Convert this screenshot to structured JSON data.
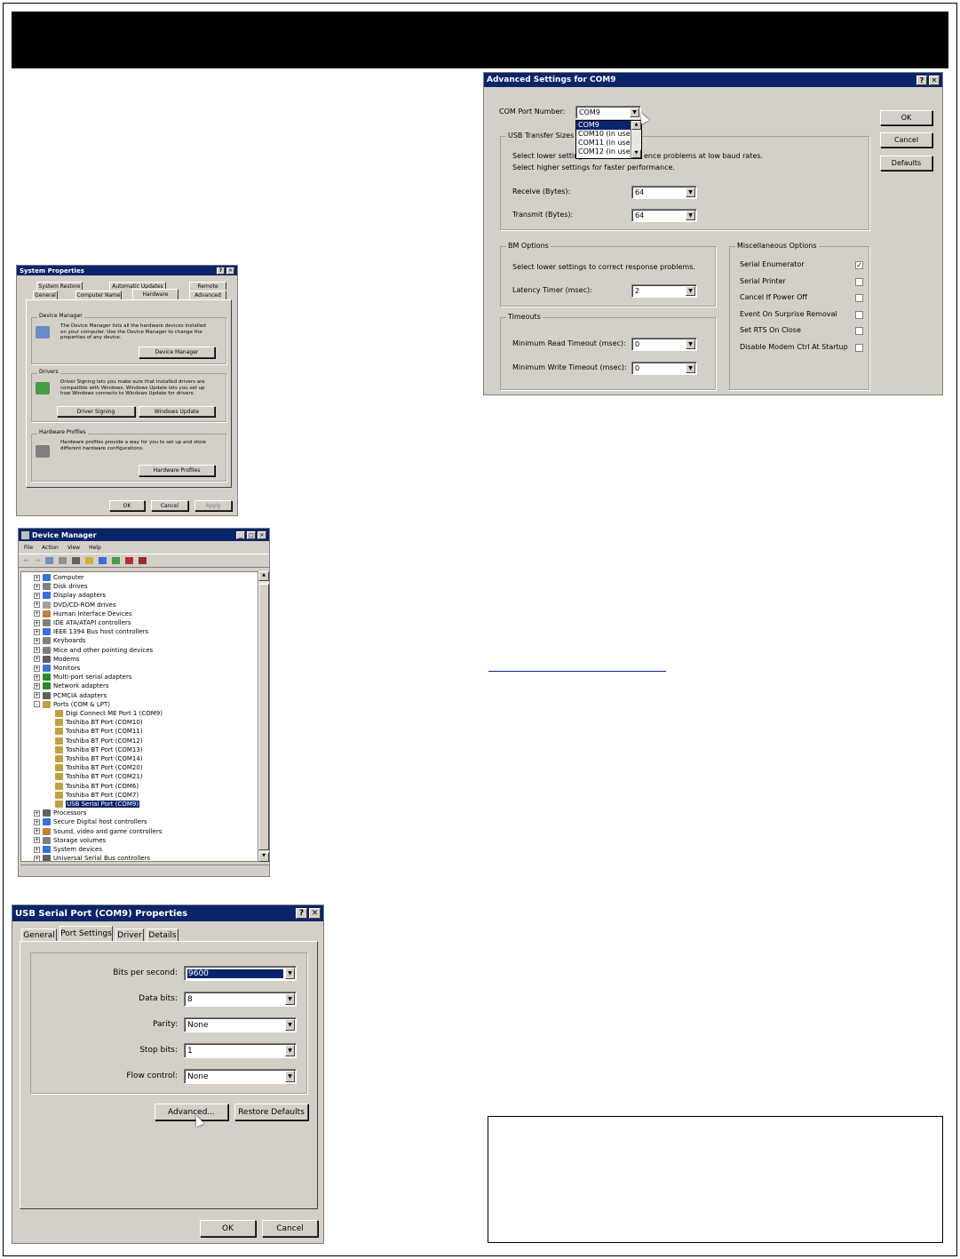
{
  "sysprop": {
    "title": "System Properties",
    "tabs_top": [
      "System Restore",
      "Automatic Updates",
      "Remote"
    ],
    "tabs_bottom": [
      "General",
      "Computer Name",
      "Hardware",
      "Advanced"
    ],
    "device_manager": {
      "group": "Device Manager",
      "text": "The Device Manager lists all the hardware devices installed on your computer. Use the Device Manager to change the properties of any device.",
      "button": "Device Manager"
    },
    "drivers": {
      "group": "Drivers",
      "text": "Driver Signing lets you make sure that installed drivers are compatible with Windows. Windows Update lets you set up how Windows connects to Windows Update for drivers.",
      "btn_signing": "Driver Signing",
      "btn_update": "Windows Update"
    },
    "profiles": {
      "group": "Hardware Profiles",
      "text": "Hardware profiles provide a way for you to set up and store different hardware configurations.",
      "button": "Hardware Profiles"
    },
    "ok": "OK",
    "cancel": "Cancel",
    "apply": "Apply"
  },
  "devmgr": {
    "title": "Device Manager",
    "menu": [
      "File",
      "Action",
      "View",
      "Help"
    ],
    "tree": [
      {
        "label": "Computer",
        "color": "#3a6fd8",
        "exp": "+"
      },
      {
        "label": "Disk drives",
        "color": "#808080",
        "exp": "+"
      },
      {
        "label": "Display adapters",
        "color": "#3a6fd8",
        "exp": "+"
      },
      {
        "label": "DVD/CD-ROM drives",
        "color": "#a0a0a0",
        "exp": "+"
      },
      {
        "label": "Human Interface Devices",
        "color": "#c08040",
        "exp": "+"
      },
      {
        "label": "IDE ATA/ATAPI controllers",
        "color": "#808080",
        "exp": "+"
      },
      {
        "label": "IEEE 1394 Bus host controllers",
        "color": "#3a6fd8",
        "exp": "+"
      },
      {
        "label": "Keyboards",
        "color": "#808080",
        "exp": "+"
      },
      {
        "label": "Mice and other pointing devices",
        "color": "#808080",
        "exp": "+"
      },
      {
        "label": "Modems",
        "color": "#606060",
        "exp": "+"
      },
      {
        "label": "Monitors",
        "color": "#3a6fd8",
        "exp": "+"
      },
      {
        "label": "Multi-port serial adapters",
        "color": "#2a8a2a",
        "exp": "+"
      },
      {
        "label": "Network adapters",
        "color": "#2a8a2a",
        "exp": "+"
      },
      {
        "label": "PCMCIA adapters",
        "color": "#606060",
        "exp": "+"
      },
      {
        "label": "Ports (COM & LPT)",
        "color": "#c0a040",
        "exp": "-"
      },
      {
        "label": "Digi Connect ME Port 1 (COM9)",
        "color": "#c0a040",
        "child": true
      },
      {
        "label": "Toshiba BT Port (COM10)",
        "color": "#c0a040",
        "child": true
      },
      {
        "label": "Toshiba BT Port (COM11)",
        "color": "#c0a040",
        "child": true
      },
      {
        "label": "Toshiba BT Port (COM12)",
        "color": "#c0a040",
        "child": true
      },
      {
        "label": "Toshiba BT Port (COM13)",
        "color": "#c0a040",
        "child": true
      },
      {
        "label": "Toshiba BT Port (COM14)",
        "color": "#c0a040",
        "child": true
      },
      {
        "label": "Toshiba BT Port (COM20)",
        "color": "#c0a040",
        "child": true
      },
      {
        "label": "Toshiba BT Port (COM21)",
        "color": "#c0a040",
        "child": true
      },
      {
        "label": "Toshiba BT Port (COM6)",
        "color": "#c0a040",
        "child": true
      },
      {
        "label": "Toshiba BT Port (COM7)",
        "color": "#c0a040",
        "child": true
      },
      {
        "label": "USB Serial Port (COM9)",
        "color": "#c0a040",
        "child": true,
        "selected": true
      },
      {
        "label": "Processors",
        "color": "#606060",
        "exp": "+"
      },
      {
        "label": "Secure Digital host controllers",
        "color": "#3a6fd8",
        "exp": "+"
      },
      {
        "label": "Sound, video and game controllers",
        "color": "#c08040",
        "exp": "+"
      },
      {
        "label": "Storage volumes",
        "color": "#808080",
        "exp": "+"
      },
      {
        "label": "System devices",
        "color": "#3a6fd8",
        "exp": "+"
      },
      {
        "label": "Universal Serial Bus controllers",
        "color": "#606060",
        "exp": "+"
      }
    ]
  },
  "usbprop": {
    "title": "USB Serial Port (COM9) Properties",
    "tabs": [
      "General",
      "Port Settings",
      "Driver",
      "Details"
    ],
    "fields": [
      {
        "label": "Bits per second:",
        "value": "9600",
        "selected": true
      },
      {
        "label": "Data bits:",
        "value": "8"
      },
      {
        "label": "Parity:",
        "value": "None"
      },
      {
        "label": "Stop bits:",
        "value": "1"
      },
      {
        "label": "Flow control:",
        "value": "None"
      }
    ],
    "advanced": "Advanced...",
    "restore": "Restore Defaults",
    "ok": "OK",
    "cancel": "Cancel"
  },
  "advanced": {
    "title": "Advanced Settings for COM9",
    "com_label": "COM Port Number:",
    "com_value": "COM9",
    "com_options": [
      "COM9",
      "COM10 (in use)",
      "COM11 (in use)",
      "COM12 (in use)"
    ],
    "usb_group": "USB Transfer Sizes",
    "usb_text1": "Select lower settings to correct performance problems at low baud rates.",
    "usb_text1_visible": "Select lower setting",
    "usb_text1_tail": "ence problems at low baud rates.",
    "usb_text2": "Select higher settings for faster performance.",
    "receive_label": "Receive (Bytes):",
    "receive_value": "64",
    "transmit_label": "Transmit (Bytes):",
    "transmit_value": "64",
    "bm_group": "BM Options",
    "bm_text": "Select lower settings to correct response problems.",
    "latency_label": "Latency Timer (msec):",
    "latency_value": "2",
    "timeouts_group": "Timeouts",
    "read_label": "Minimum Read Timeout (msec):",
    "read_value": "0",
    "write_label": "Minimum Write Timeout (msec):",
    "write_value": "0",
    "misc_group": "Miscellaneous Options",
    "misc": [
      {
        "label": "Serial Enumerator",
        "checked": true
      },
      {
        "label": "Serial Printer",
        "checked": false
      },
      {
        "label": "Cancel If Power Off",
        "checked": false
      },
      {
        "label": "Event On Surprise Removal",
        "checked": false
      },
      {
        "label": "Set RTS On Close",
        "checked": false
      },
      {
        "label": "Disable Modem Ctrl At Startup",
        "checked": false
      }
    ],
    "ok": "OK",
    "cancel": "Cancel",
    "defaults": "Defaults"
  },
  "colors": {
    "titlebar": "#0a246a",
    "dialog": "#d4d0c8",
    "banner": "#000000"
  }
}
